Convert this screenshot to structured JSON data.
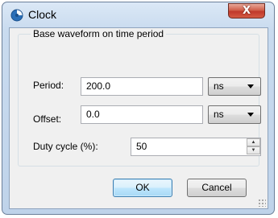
{
  "window": {
    "title": "Clock",
    "close_glyph": "X"
  },
  "group": {
    "label": "Base waveform on time period"
  },
  "period": {
    "label": "Period:",
    "value": "200.0",
    "unit": "ns"
  },
  "offset": {
    "label": "Offset:",
    "value": "0.0",
    "unit": "ns"
  },
  "duty": {
    "label": "Duty cycle (%):",
    "value": "50"
  },
  "buttons": {
    "ok": "OK",
    "cancel": "Cancel"
  },
  "icons": {
    "app": "clock-app-icon",
    "close": "close-icon",
    "dropdown": "chevron-down-icon",
    "spin_up": "spin-up-icon",
    "spin_down": "spin-down-icon"
  }
}
